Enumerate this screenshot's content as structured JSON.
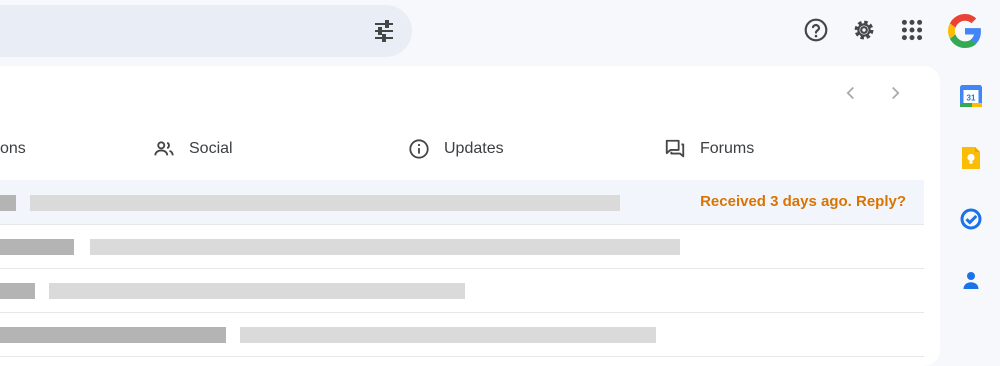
{
  "header": {
    "search_options_icon": "tune-icon",
    "help_icon": "help-circle-icon",
    "settings_icon": "gear-icon",
    "apps_icon": "apps-grid-icon",
    "account_logo": "google-g-logo"
  },
  "pagination": {
    "prev_icon": "chevron-left-icon",
    "next_icon": "chevron-right-icon"
  },
  "tabs": [
    {
      "label": "ons",
      "icon": null
    },
    {
      "label": "Social",
      "icon": "people-icon"
    },
    {
      "label": "Updates",
      "icon": "info-icon"
    },
    {
      "label": "Forums",
      "icon": "forum-icon"
    }
  ],
  "messages": [
    {
      "nudge": "Received 3 days ago. Reply?",
      "selected": true
    },
    {
      "nudge": ""
    },
    {
      "nudge": ""
    },
    {
      "nudge": ""
    }
  ],
  "side_panel": {
    "calendar_label": "31",
    "icons": [
      "calendar-icon",
      "keep-icon",
      "tasks-icon",
      "contacts-icon"
    ]
  },
  "colors": {
    "nudge": "#d97400",
    "accent_blue": "#1a73e8",
    "keep_yellow": "#fbbc04"
  }
}
